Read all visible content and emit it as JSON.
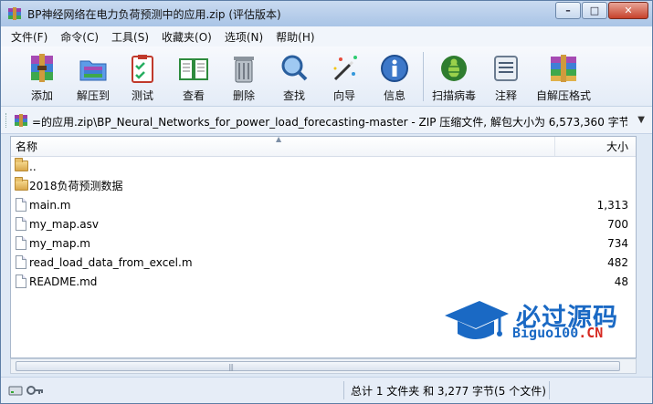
{
  "window": {
    "title": "BP神经网络在电力负荷预测中的应用.zip (评估版本)",
    "controls": {
      "minimize": "–",
      "maximize": "□",
      "close": "✕"
    }
  },
  "menu": [
    "文件(F)",
    "命令(C)",
    "工具(S)",
    "收藏夹(O)",
    "选项(N)",
    "帮助(H)"
  ],
  "toolbar": [
    {
      "label": "添加",
      "icon": "add-archive-icon"
    },
    {
      "label": "解压到",
      "icon": "extract-to-icon"
    },
    {
      "label": "测试",
      "icon": "test-clipboard-icon"
    },
    {
      "label": "查看",
      "icon": "view-book-icon"
    },
    {
      "label": "删除",
      "icon": "trash-icon"
    },
    {
      "label": "查找",
      "icon": "find-magnifier-icon"
    },
    {
      "label": "向导",
      "icon": "wizard-wand-icon"
    },
    {
      "label": "信息",
      "icon": "info-icon"
    },
    {
      "label": "扫描病毒",
      "icon": "virus-scan-bug-icon"
    },
    {
      "label": "注释",
      "icon": "comment-icon"
    },
    {
      "label": "自解压格式",
      "icon": "sfx-boxes-icon"
    }
  ],
  "address": {
    "path": "=的应用.zip\\BP_Neural_Networks_for_power_load_forecasting-master - ZIP 压缩文件, 解包大小为 6,573,360 字节"
  },
  "columns": {
    "name": "名称",
    "size": "大小"
  },
  "files": [
    {
      "name": "..",
      "size": "",
      "type": "parent"
    },
    {
      "name": "2018负荷预测数据",
      "size": "",
      "type": "folder"
    },
    {
      "name": "main.m",
      "size": "1,313",
      "type": "file"
    },
    {
      "name": "my_map.asv",
      "size": "700",
      "type": "file"
    },
    {
      "name": "my_map.m",
      "size": "734",
      "type": "file"
    },
    {
      "name": "read_load_data_from_excel.m",
      "size": "482",
      "type": "file"
    },
    {
      "name": "README.md",
      "size": "48",
      "type": "file"
    }
  ],
  "status": {
    "text": "总计 1 文件夹 和 3,277 字节(5 个文件)"
  },
  "watermark": {
    "cn": "必过源码",
    "en_main": "Biguo100",
    "en_suffix": ".CN"
  },
  "colors": {
    "accent": "#1a69c4",
    "watermark_red": "#d62a22"
  }
}
